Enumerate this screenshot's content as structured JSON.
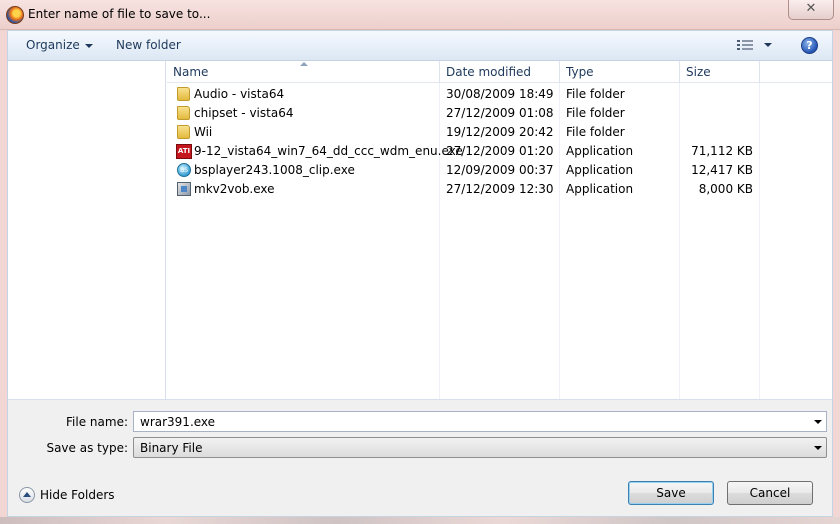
{
  "window": {
    "title": "Enter name of file to save to...",
    "close_glyph": "✕"
  },
  "toolbar": {
    "organize_label": "Organize",
    "new_folder_label": "New folder",
    "help_glyph": "?"
  },
  "columns": {
    "name": "Name",
    "date_modified": "Date modified",
    "type": "Type",
    "size": "Size"
  },
  "files": [
    {
      "icon": "folder-icon",
      "name": "Audio - vista64",
      "date": "30/08/2009 18:49",
      "type": "File folder",
      "size": ""
    },
    {
      "icon": "folder-icon",
      "name": "chipset - vista64",
      "date": "27/12/2009 01:08",
      "type": "File folder",
      "size": ""
    },
    {
      "icon": "folder-icon",
      "name": "Wii",
      "date": "19/12/2009 20:42",
      "type": "File folder",
      "size": ""
    },
    {
      "icon": "ati-installer-icon",
      "icon_text": "ATI",
      "name": "9-12_vista64_win7_64_dd_ccc_wdm_enu.exe",
      "date": "27/12/2009 01:20",
      "type": "Application",
      "size": "71,112 KB"
    },
    {
      "icon": "bsplayer-icon",
      "icon_text": "BS",
      "name": "bsplayer243.1008_clip.exe",
      "date": "12/09/2009 00:37",
      "type": "Application",
      "size": "12,417 KB"
    },
    {
      "icon": "application-icon",
      "name": "mkv2vob.exe",
      "date": "27/12/2009 12:30",
      "type": "Application",
      "size": "8,000 KB"
    }
  ],
  "form": {
    "file_name_label": "File name:",
    "file_name_value": "wrar391.exe",
    "save_as_type_label": "Save as type:",
    "save_as_type_value": "Binary File"
  },
  "footer": {
    "hide_folders_label": "Hide Folders",
    "save_label": "Save",
    "cancel_label": "Cancel"
  }
}
